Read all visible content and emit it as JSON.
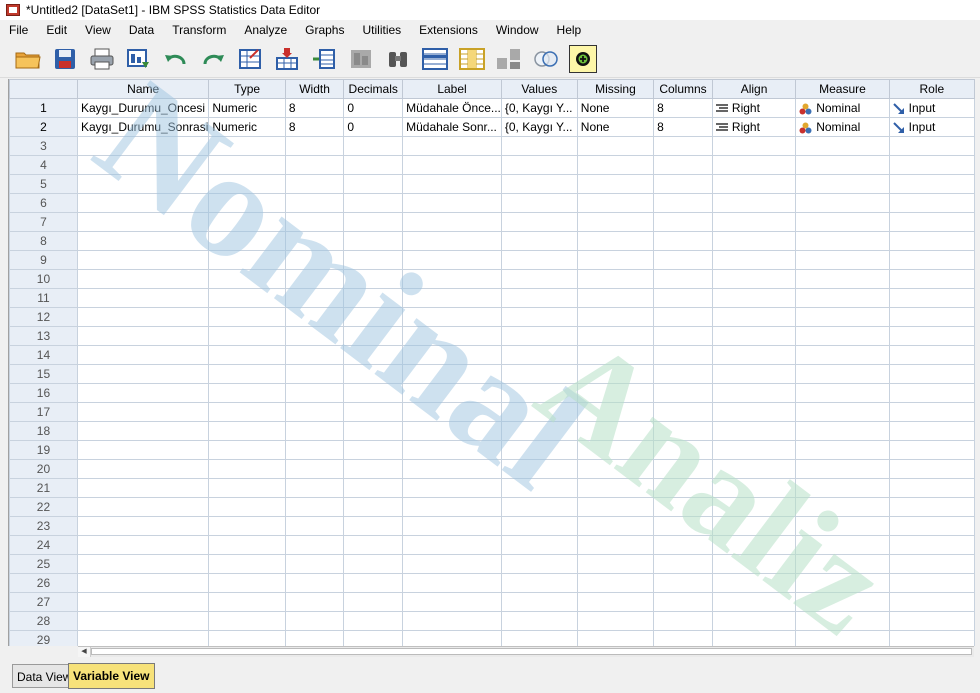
{
  "window": {
    "title": "*Untitled2 [DataSet1] - IBM SPSS Statistics Data Editor"
  },
  "menu": [
    {
      "label": "File"
    },
    {
      "label": "Edit"
    },
    {
      "label": "View"
    },
    {
      "label": "Data"
    },
    {
      "label": "Transform"
    },
    {
      "label": "Analyze"
    },
    {
      "label": "Graphs"
    },
    {
      "label": "Utilities"
    },
    {
      "label": "Extensions"
    },
    {
      "label": "Window"
    },
    {
      "label": "Help"
    }
  ],
  "grid": {
    "columns": [
      "Name",
      "Type",
      "Width",
      "Decimals",
      "Label",
      "Values",
      "Missing",
      "Columns",
      "Align",
      "Measure",
      "Role"
    ],
    "rows": [
      {
        "num": "1",
        "name": "Kaygı_Durumu_Oncesi",
        "type": "Numeric",
        "width": "8",
        "decimals": "0",
        "label": "Müdahale Önce...",
        "values": "{0, Kaygı Y...",
        "missing": "None",
        "columns": "8",
        "align": "Right",
        "measure": "Nominal",
        "role": "Input"
      },
      {
        "num": "2",
        "name": "Kaygı_Durumu_Sonrasi",
        "type": "Numeric",
        "width": "8",
        "decimals": "0",
        "label": "Müdahale Sonr...",
        "values": "{0, Kaygı Y...",
        "missing": "None",
        "columns": "8",
        "align": "Right",
        "measure": "Nominal",
        "role": "Input"
      }
    ],
    "empty_row_numbers": [
      "3",
      "4",
      "5",
      "6",
      "7",
      "8",
      "9",
      "10",
      "11",
      "12",
      "13",
      "14",
      "15",
      "16",
      "17",
      "18",
      "19",
      "20",
      "21",
      "22",
      "23",
      "24",
      "25",
      "26",
      "27",
      "28",
      "29"
    ]
  },
  "tabs": {
    "data_view": "Data View",
    "variable_view": "Variable View"
  },
  "watermark": {
    "line1": "Nominal",
    "line2": "Analiz",
    "color1": "#9ec3df",
    "color2": "#b7e0c6"
  },
  "colors": {
    "header_bg": "#e8eef6",
    "active_tab": "#f7e27a"
  }
}
